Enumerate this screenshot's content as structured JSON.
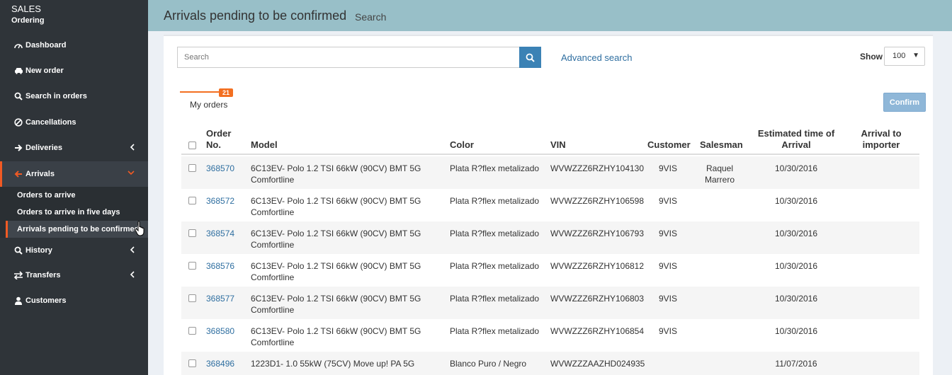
{
  "sidebar": {
    "app_title": "SALES",
    "app_subtitle": "Ordering",
    "items": [
      {
        "label": "Dashboard",
        "icon": "dashboard-icon"
      },
      {
        "label": "New order",
        "icon": "car-icon"
      },
      {
        "label": "Search in orders",
        "icon": "search-icon"
      },
      {
        "label": "Cancellations",
        "icon": "ban-icon"
      },
      {
        "label": "Deliveries",
        "icon": "arrow-right-icon"
      },
      {
        "label": "Arrivals",
        "icon": "arrow-left-icon"
      },
      {
        "label": "History",
        "icon": "search-icon"
      },
      {
        "label": "Transfers",
        "icon": "exchange-icon"
      },
      {
        "label": "Customers",
        "icon": "user-icon"
      }
    ],
    "arrivals_submenu": [
      {
        "label": "Orders to arrive"
      },
      {
        "label": "Orders to arrive in five days"
      },
      {
        "label": "Arrivals pending to be confirmed"
      }
    ]
  },
  "header": {
    "title": "Arrivals pending to be confirmed",
    "breadcrumb": "Search"
  },
  "toolbar": {
    "search_placeholder": "Search",
    "advanced_search": "Advanced search",
    "show_label": "Show",
    "show_value": "100"
  },
  "tabs": {
    "my_orders": "My orders",
    "my_orders_count": "21"
  },
  "confirm_label": "Confirm",
  "table": {
    "headers": {
      "order_no": "Order No.",
      "model": "Model",
      "color": "Color",
      "vin": "VIN",
      "customer": "Customer",
      "salesman": "Salesman",
      "eta": "Estimated time of Arrival",
      "arrival_importer": "Arrival to importer"
    },
    "rows": [
      {
        "order": "368570",
        "model": "6C13EV- Polo 1.2 TSI 66kW (90CV) BMT 5G Comfortline",
        "color": "Plata R?flex metalizado",
        "vin": "WVWZZZ6RZHY104130",
        "customer": "9VIS",
        "salesman": "Raquel Marrero",
        "eta": "10/30/2016",
        "arrival": ""
      },
      {
        "order": "368572",
        "model": "6C13EV- Polo 1.2 TSI 66kW (90CV) BMT 5G Comfortline",
        "color": "Plata R?flex metalizado",
        "vin": "WVWZZZ6RZHY106598",
        "customer": "9VIS",
        "salesman": "",
        "eta": "10/30/2016",
        "arrival": ""
      },
      {
        "order": "368574",
        "model": "6C13EV- Polo 1.2 TSI 66kW (90CV) BMT 5G Comfortline",
        "color": "Plata R?flex metalizado",
        "vin": "WVWZZZ6RZHY106793",
        "customer": "9VIS",
        "salesman": "",
        "eta": "10/30/2016",
        "arrival": ""
      },
      {
        "order": "368576",
        "model": "6C13EV- Polo 1.2 TSI 66kW (90CV) BMT 5G Comfortline",
        "color": "Plata R?flex metalizado",
        "vin": "WVWZZZ6RZHY106812",
        "customer": "9VIS",
        "salesman": "",
        "eta": "10/30/2016",
        "arrival": ""
      },
      {
        "order": "368577",
        "model": "6C13EV- Polo 1.2 TSI 66kW (90CV) BMT 5G Comfortline",
        "color": "Plata R?flex metalizado",
        "vin": "WVWZZZ6RZHY106803",
        "customer": "9VIS",
        "salesman": "",
        "eta": "10/30/2016",
        "arrival": ""
      },
      {
        "order": "368580",
        "model": "6C13EV- Polo 1.2 TSI 66kW (90CV) BMT 5G Comfortline",
        "color": "Plata R?flex metalizado",
        "vin": "WVWZZZ6RZHY106854",
        "customer": "9VIS",
        "salesman": "",
        "eta": "10/30/2016",
        "arrival": ""
      },
      {
        "order": "368496",
        "model": "1223D1- 1.0 55kW (75CV) Move up! PA 5G",
        "color": "Blanco Puro / Negro",
        "vin": "WVWZZZAAZHD024935",
        "customer": "",
        "salesman": "",
        "eta": "11/07/2016",
        "arrival": ""
      }
    ]
  },
  "colors": {
    "sidebar_bg": "#2f3439",
    "header_bg": "#98bfc8",
    "accent": "#f15a24",
    "link": "#2e6ea0",
    "primary_button": "#3b82b5"
  }
}
